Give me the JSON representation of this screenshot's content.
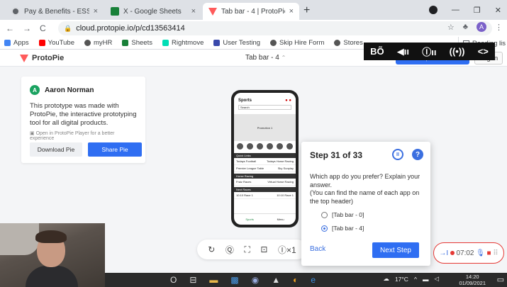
{
  "browser": {
    "tabs": [
      {
        "title": "Pay & Benefits - ESS",
        "icon": "chrome-icon"
      },
      {
        "title": "X - Google Sheets",
        "icon": "sheets-icon"
      },
      {
        "title": "Tab bar - 4 | ProtoPie Cloud",
        "icon": "protopie-icon",
        "active": true
      }
    ],
    "close_glyph": "×",
    "new_tab": "+",
    "url": "cloud.protopie.io/p/cd13563414",
    "profile_initial": "A",
    "bookmarks": [
      "Apps",
      "YouTube",
      "myHR",
      "Sheets",
      "Rightmove",
      "User Testing",
      "Skip Hire Form",
      "Stores"
    ],
    "reading_list": "Reading lis"
  },
  "protopie": {
    "logo": "ProtoPie",
    "scene": "Tab bar - 4",
    "scene_caret": "⌃",
    "signup": "Download, Install for free",
    "login": "Log In",
    "card": {
      "author_initial": "A",
      "author": "Aaron Norman",
      "description": "This prototype was made with ProtoPie, the interactive prototyping tool for all digital products.",
      "open_player": "Open in ProtoPie Player for a better experience",
      "download": "Download Pie",
      "share": "Share Pie"
    },
    "phone": {
      "title": "Sports",
      "search": "Search",
      "banner": "Promotion 1",
      "section1": "Quick Links",
      "row1a": "Todays Football",
      "row1b": "Todays Horse Racing",
      "row2a": "Premier League Table",
      "row2b": "Sky Sunplay",
      "section2": "Horse Racing",
      "row3a": "Fraiz Races",
      "row3b": "Virtual Horse Racing",
      "section3": "Next Races",
      "row4a": "10:10 Race 1",
      "row4b": "10:10 Race 1",
      "tab1": "Sports",
      "tab2": "Menu"
    }
  },
  "media_bar": [
    "BÕ",
    "◀ıı",
    "Ⓘıı",
    "((•))",
    "<>"
  ],
  "controls": [
    "↻",
    "Ⓠ",
    "⛶",
    "⊡",
    "Ⓘ×1"
  ],
  "step": {
    "title": "Step 31 of 33",
    "pause": "II",
    "help": "?",
    "question": "Which app do you prefer? Explain your answer.",
    "hint": "(You can find the name of each app on the top header)",
    "options": [
      {
        "label": "[Tab bar - 0]",
        "selected": false
      },
      {
        "label": "[Tab bar - 4]",
        "selected": true
      }
    ],
    "back": "Back",
    "next": "Next Step"
  },
  "recorder": {
    "time": "07:02",
    "collapse": "→I",
    "mic": "🎙",
    "cam": "■",
    "grip": "⠿"
  },
  "taskbar": {
    "weather": "17°C",
    "time": "14:20",
    "date": "01/09/2021",
    "icons": [
      "O",
      "⊟",
      "▬",
      "▩",
      "◉",
      "▲",
      "◐",
      "e"
    ]
  },
  "window_controls": [
    "—",
    "❐",
    "✕"
  ],
  "toolbar_icons": {
    "back": "←",
    "forward": "→",
    "reload": "C",
    "lock": "🔒",
    "star": "☆",
    "ext": "♣",
    "menu": "⋮"
  },
  "colors": {
    "accent": "#2f6ef2",
    "brand": "#ff5b5b",
    "record": "#e53935"
  }
}
